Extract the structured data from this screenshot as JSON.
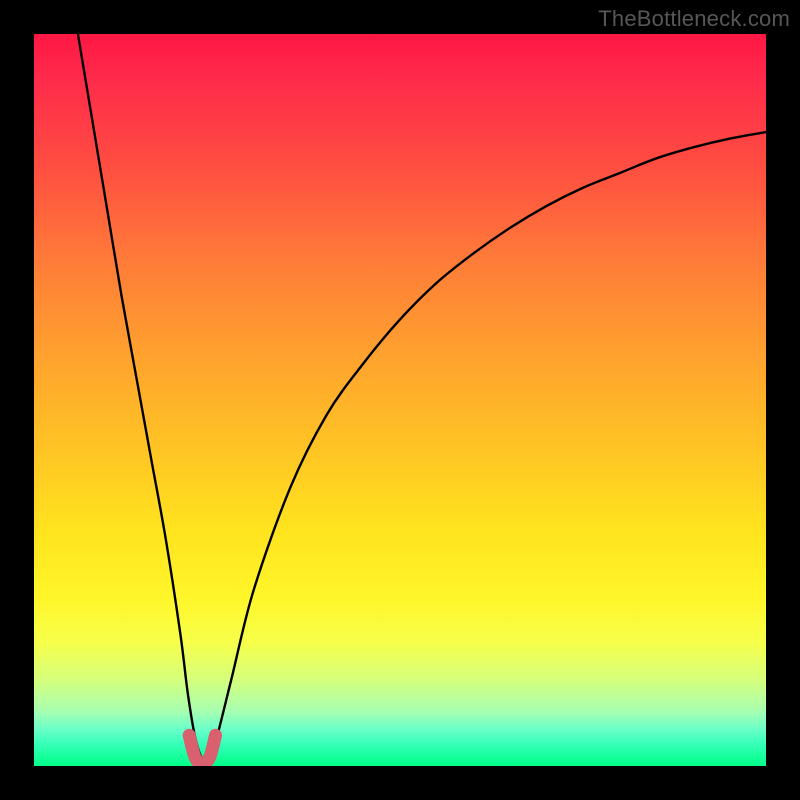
{
  "watermark": "TheBottleneck.com",
  "chart_data": {
    "type": "line",
    "title": "",
    "xlabel": "",
    "ylabel": "",
    "xlim": [
      0,
      100
    ],
    "ylim": [
      0,
      100
    ],
    "grid": false,
    "legend": false,
    "series": [
      {
        "name": "bottleneck-curve",
        "x": [
          6,
          8,
          10,
          12,
          14,
          16,
          18,
          20,
          21,
          22,
          23,
          24,
          25,
          27,
          30,
          35,
          40,
          45,
          50,
          55,
          60,
          65,
          70,
          75,
          80,
          85,
          90,
          95,
          100
        ],
        "y": [
          100,
          88,
          76,
          64,
          53,
          42,
          31,
          18,
          10,
          4,
          1,
          1,
          4,
          12,
          24,
          38,
          48,
          55,
          61,
          66,
          70,
          73.5,
          76.5,
          79,
          81,
          83,
          84.5,
          85.7,
          86.6
        ]
      },
      {
        "name": "highlight-band",
        "x": [
          21.2,
          22.0,
          23.0,
          24.0,
          24.8
        ],
        "y": [
          4.2,
          1.2,
          0.3,
          1.2,
          4.2
        ]
      }
    ],
    "colors": {
      "curve": "#000000",
      "highlight": "#d9606e",
      "gradient_top": "#ff1744",
      "gradient_bottom": "#00ff88"
    },
    "notes": "Values are read off the figure in percent of plot area; x≈23 is the minimum (≈0). Axes are unlabeled in the source image."
  }
}
